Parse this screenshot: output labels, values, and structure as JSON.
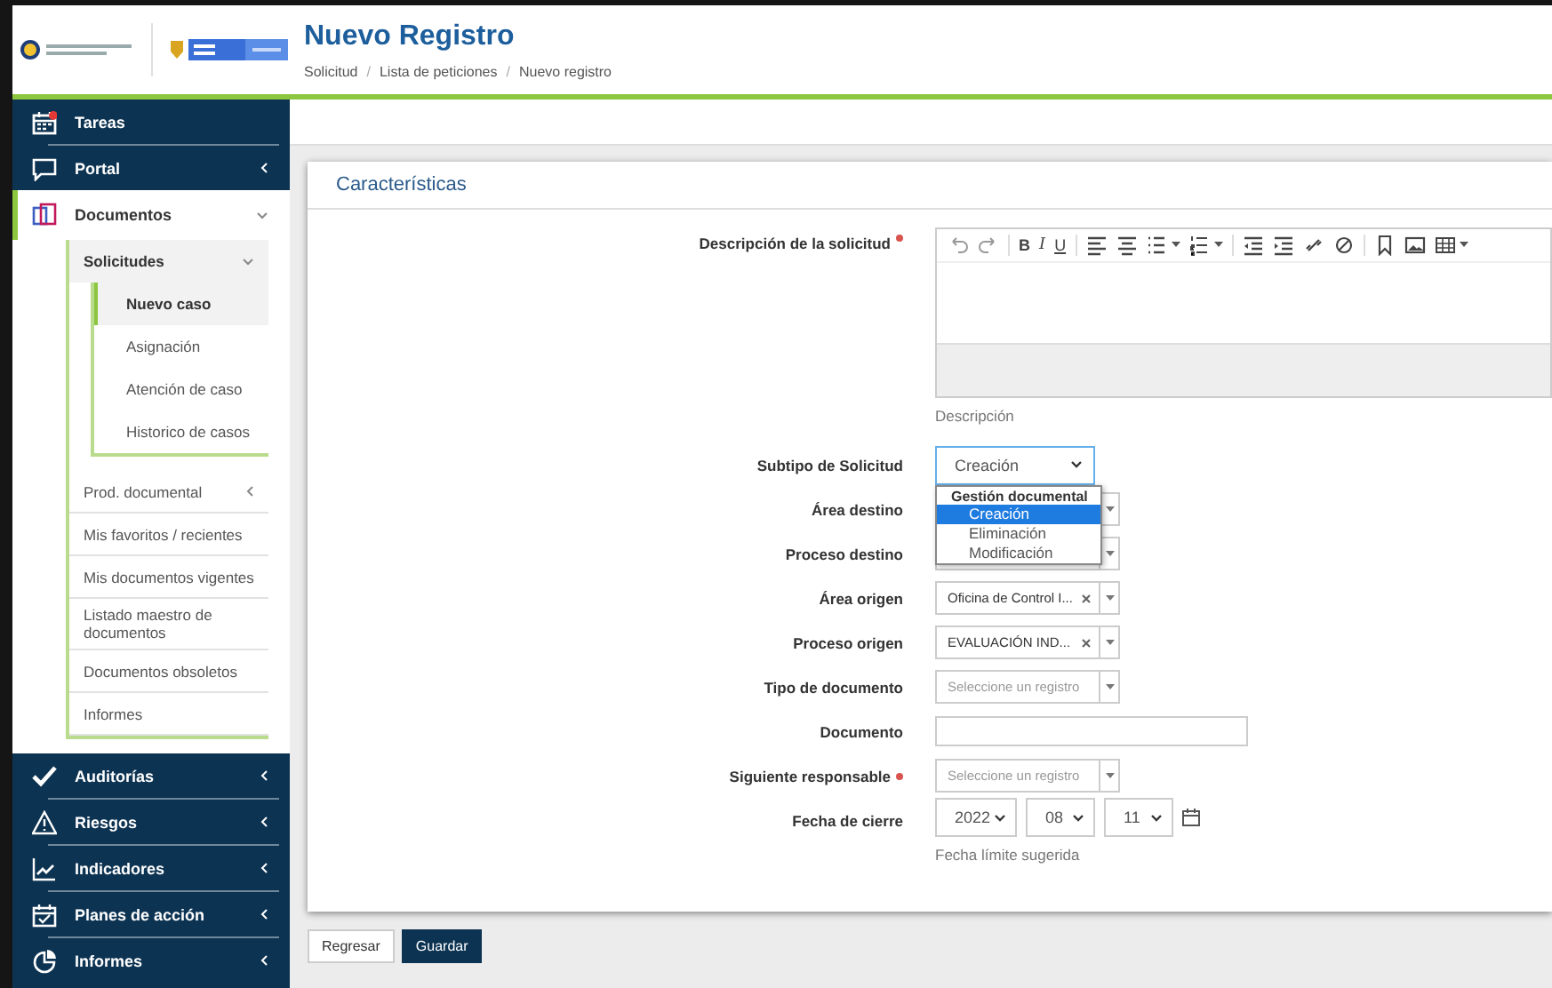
{
  "header": {
    "title": "Nuevo Registro",
    "breadcrumb": [
      "Solicitud",
      "Lista de peticiones",
      "Nuevo registro"
    ],
    "separator": "/"
  },
  "sidebar": {
    "items": [
      {
        "label": "Tareas",
        "selected": false
      },
      {
        "label": "Portal",
        "selected": false,
        "expanded": false
      },
      {
        "label": "Documentos",
        "selected": true,
        "expanded": true,
        "children": [
          {
            "label": "Solicitudes",
            "selected": true,
            "expanded": true,
            "children": [
              {
                "label": "Nuevo caso",
                "selected": true
              },
              {
                "label": "Asignación",
                "selected": false
              },
              {
                "label": "Atención de caso",
                "selected": false
              },
              {
                "label": "Historico de casos",
                "selected": false
              }
            ]
          },
          {
            "label": "Prod. documental",
            "selected": false,
            "expanded": false
          },
          {
            "label": "Mis favoritos / recientes",
            "selected": false
          },
          {
            "label": "Mis documentos vigentes",
            "selected": false
          },
          {
            "label": "Listado maestro de documentos",
            "selected": false
          },
          {
            "label": "Documentos obsoletos",
            "selected": false
          },
          {
            "label": "Informes",
            "selected": false
          }
        ]
      },
      {
        "label": "Auditorías",
        "selected": false,
        "expanded": false
      },
      {
        "label": "Riesgos",
        "selected": false,
        "expanded": false
      },
      {
        "label": "Indicadores",
        "selected": false,
        "expanded": false
      },
      {
        "label": "Planes de acción",
        "selected": false,
        "expanded": false
      },
      {
        "label": "Informes",
        "selected": false,
        "expanded": false
      }
    ]
  },
  "card": {
    "title": "Características",
    "fields": [
      {
        "kind": "editor",
        "label": "Descripción de la solicitud",
        "required": true,
        "hint": "Descripción",
        "toolbar": [
          {
            "kind": "undo"
          },
          {
            "kind": "redo"
          },
          {
            "kind": "sep"
          },
          {
            "kind": "bold",
            "label": "B"
          },
          {
            "kind": "italic",
            "label": "I"
          },
          {
            "kind": "underline",
            "label": "U"
          },
          {
            "kind": "sep"
          },
          {
            "kind": "align-left"
          },
          {
            "kind": "align-center"
          },
          {
            "kind": "bullets"
          },
          {
            "kind": "numbers"
          },
          {
            "kind": "sep"
          },
          {
            "kind": "outdent"
          },
          {
            "kind": "indent"
          },
          {
            "kind": "link"
          },
          {
            "kind": "unlink"
          },
          {
            "kind": "sep"
          },
          {
            "kind": "bookmark"
          },
          {
            "kind": "image"
          },
          {
            "kind": "table"
          }
        ]
      },
      {
        "kind": "select",
        "label": "Subtipo de Solicitud",
        "value": "Creación",
        "focused": true,
        "dropdown": {
          "group": "Gestión documental",
          "options": [
            {
              "label": "Creación",
              "selected": true
            },
            {
              "label": "Eliminación",
              "selected": false
            },
            {
              "label": "Modificación",
              "selected": false
            }
          ]
        }
      },
      {
        "kind": "select2",
        "label": "Área destino"
      },
      {
        "kind": "select2",
        "label": "Proceso destino"
      },
      {
        "kind": "select2",
        "label": "Área origen",
        "value": "Oficina de Control I..."
      },
      {
        "kind": "select2",
        "label": "Proceso origen",
        "value": "EVALUACIÓN IND..."
      },
      {
        "kind": "select2",
        "label": "Tipo de documento",
        "placeholder": "Seleccione un registro"
      },
      {
        "kind": "text",
        "label": "Documento"
      },
      {
        "kind": "select2",
        "label": "Siguiente responsable",
        "required": true,
        "placeholder": "Seleccione un registro"
      },
      {
        "kind": "date",
        "label": "Fecha de cierre",
        "parts": [
          "2022",
          "08",
          "11"
        ],
        "hint": "Fecha límite sugerida"
      }
    ]
  },
  "buttons": [
    {
      "label": "Regresar",
      "primary": false
    },
    {
      "label": "Guardar",
      "primary": true
    }
  ]
}
